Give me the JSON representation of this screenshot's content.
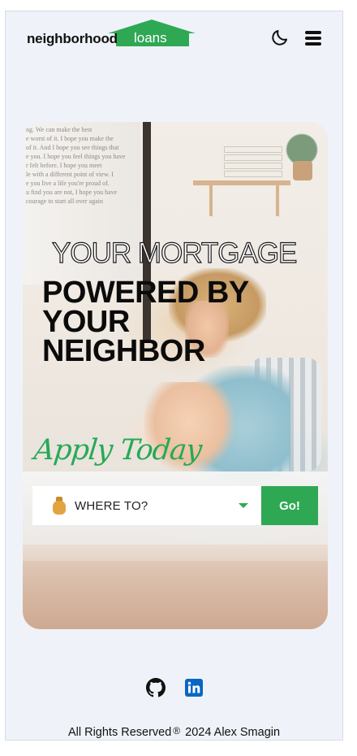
{
  "header": {
    "logo_word1": "neighborhood",
    "logo_word2": "loans",
    "theme_toggle_icon": "moon-icon",
    "menu_icon": "hamburger-icon"
  },
  "hero": {
    "wall_text": "ng. We can make the best\ne worst of it. I hope you make the\nof it. And I hope you see things that\ne you. I hope you feel things you have\nr felt before. I hope you meet\nle with a different point of view. I\ne you live a life you're proud of.\nu find you are not, I hope you have\ncourage to start all over again",
    "kicker": "YOUR MORTGAGE",
    "title_lines": [
      "POWERED BY",
      "YOUR",
      "NEIGHBOR"
    ],
    "apply_text": "Apply Today"
  },
  "search": {
    "select_icon": "money-bag-icon",
    "select_label": "WHERE TO?",
    "go_label": "Go!"
  },
  "footer": {
    "github_icon": "github-icon",
    "linkedin_icon": "linkedin-icon",
    "copyright_prefix": "All Rights Reserved",
    "reg_symbol": "®",
    "copyright_suffix": "2024  Alex Smagin"
  },
  "colors": {
    "brand_green": "#2fa854",
    "background": "#eff3f9",
    "linkedin_blue": "#0a66c2"
  }
}
